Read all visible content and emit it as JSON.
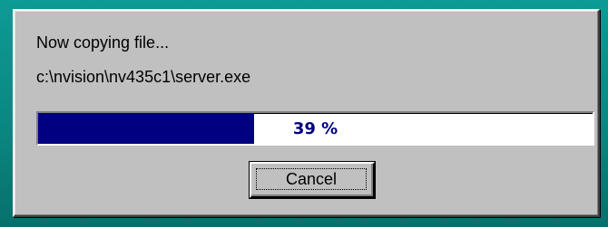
{
  "dialog": {
    "status_text": "Now copying file...",
    "file_path": "c:\\nvision\\nv435c1\\server.exe",
    "progress": {
      "percent": 39,
      "label": "39 %",
      "fill_color": "#000080"
    },
    "cancel_label": "Cancel"
  },
  "colors": {
    "desktop": "#0b8a86",
    "dialog_face": "#c0c0c0",
    "progress_fill": "#000080",
    "progress_text": "#000080"
  }
}
